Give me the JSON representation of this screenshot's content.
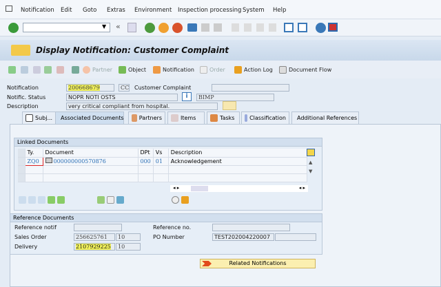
{
  "menu": [
    "Notification",
    "Edit",
    "Goto",
    "Extras",
    "Environment",
    "Inspection processing",
    "System",
    "Help"
  ],
  "command_field": {
    "value": ""
  },
  "title": "Display Notification: Customer Complaint",
  "app_toolbar": {
    "partner": "Partner",
    "object": "Object",
    "notification": "Notification",
    "order": "Order",
    "action_log": "Action Log",
    "document_flow": "Document Flow"
  },
  "header": {
    "notification_label": "Notification",
    "notification_value": "200668679",
    "type": "CC",
    "type_text": "Customer Complaint",
    "status_label": "Notific. Status",
    "status_value": "NOPR NOTI OSTS",
    "user_status": "BIMP",
    "description_label": "Description",
    "description_value": "very critical compliant from hospital."
  },
  "tabs": [
    "Subj...",
    "Associated Documents",
    "Partners",
    "Items",
    "Tasks",
    "Classification",
    "Additional References"
  ],
  "linked_documents": {
    "title": "Linked Documents",
    "columns": [
      "Ty.",
      "Document",
      "DPt",
      "Vs",
      "Description"
    ],
    "rows": [
      {
        "type": "ZQ0",
        "document": "000000000570876",
        "dpt": "000",
        "vs": "01",
        "description": "Acknowledgement"
      }
    ]
  },
  "reference_documents": {
    "title": "Reference Documents",
    "reference_notif_label": "Reference notif",
    "reference_notif_value": "",
    "sales_order_label": "Sales Order",
    "sales_order_value": "256625761",
    "sales_order_item": "10",
    "delivery_label": "Delivery",
    "delivery_value": "2107929225",
    "delivery_item": "10",
    "reference_no_label": "Reference no.",
    "reference_no_value": "",
    "po_number_label": "PO Number",
    "po_number_value": "TEST202004220007"
  },
  "related_notifications": "Related Notifications"
}
